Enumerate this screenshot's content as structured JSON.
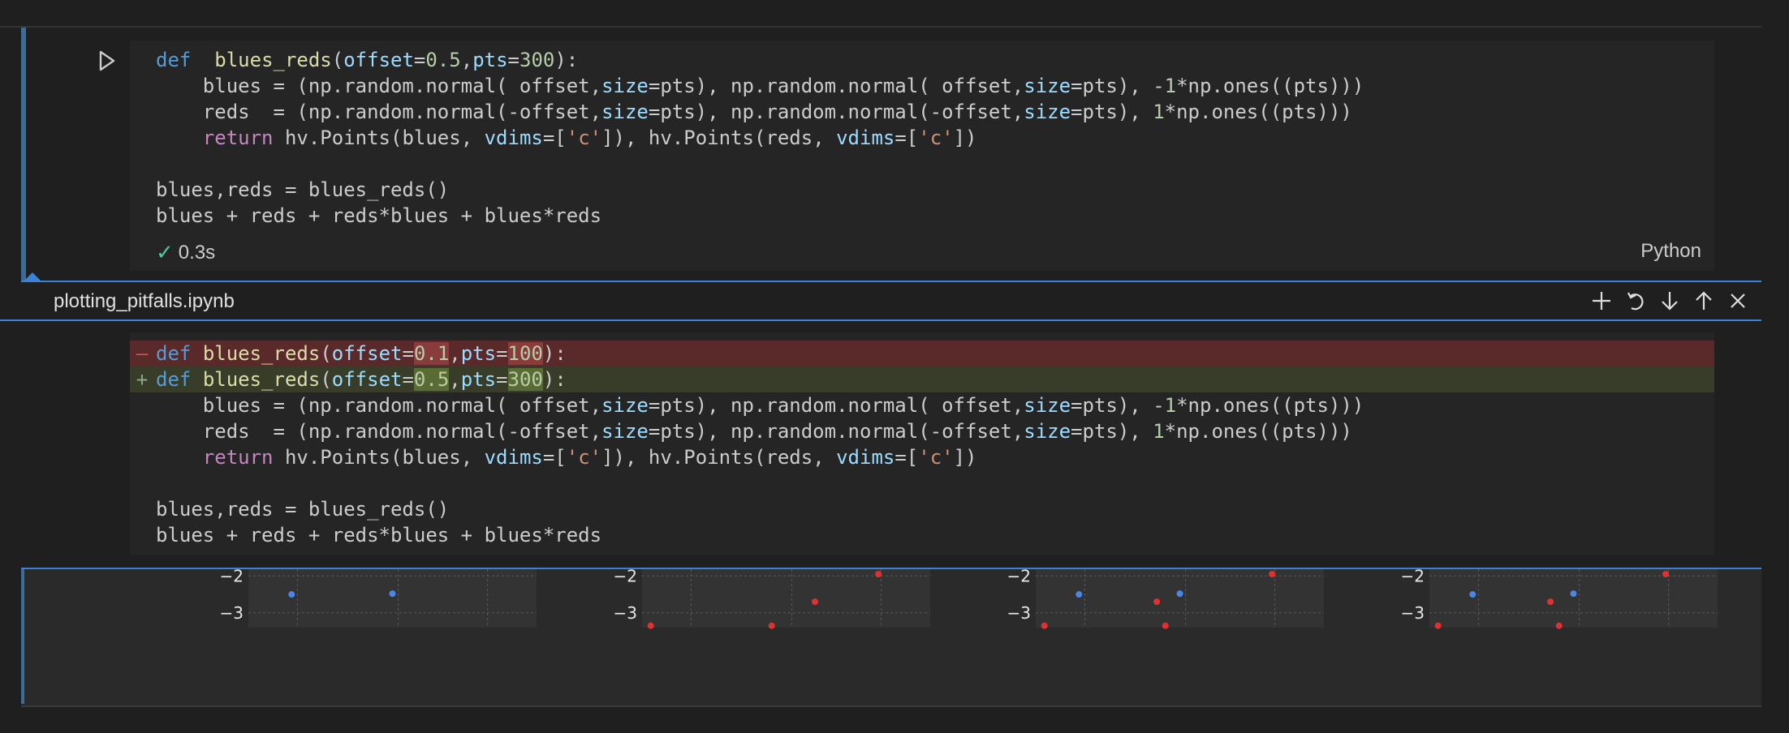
{
  "cell": {
    "code_lines": [
      [
        [
          "kw",
          "def"
        ],
        [
          "",
          "  "
        ],
        [
          "fn",
          "blues_reds"
        ],
        [
          "",
          "("
        ],
        [
          "pa-c",
          "offset"
        ],
        [
          "",
          "="
        ],
        [
          "num",
          "0.5"
        ],
        [
          "",
          ","
        ],
        [
          "pa-c",
          "pts"
        ],
        [
          "",
          "="
        ],
        [
          "num",
          "300"
        ],
        [
          "",
          "):"
        ]
      ],
      [
        [
          "",
          "    blues = (np.random.normal( offset,"
        ],
        [
          "pa-c",
          "size"
        ],
        [
          "",
          "=pts), np.random.normal( offset,"
        ],
        [
          "pa-c",
          "size"
        ],
        [
          "",
          "=pts), -"
        ],
        [
          "num",
          "1"
        ],
        [
          "",
          "*np.ones((pts)))"
        ]
      ],
      [
        [
          "",
          "    reds  = (np.random.normal(-offset,"
        ],
        [
          "pa-c",
          "size"
        ],
        [
          "",
          "=pts), np.random.normal(-offset,"
        ],
        [
          "pa-c",
          "size"
        ],
        [
          "",
          "=pts), "
        ],
        [
          "num",
          "1"
        ],
        [
          "",
          "*np.ones((pts)))"
        ]
      ],
      [
        [
          "",
          "    "
        ],
        [
          "kw2",
          "return"
        ],
        [
          "",
          " hv.Points(blues, "
        ],
        [
          "pa-c",
          "vdims"
        ],
        [
          "",
          "=["
        ],
        [
          "str",
          "'c'"
        ],
        [
          "",
          "]), hv.Points(reds, "
        ],
        [
          "pa-c",
          "vdims"
        ],
        [
          "",
          "=["
        ],
        [
          "str",
          "'c'"
        ],
        [
          "",
          "])"
        ]
      ],
      [
        [
          "",
          ""
        ]
      ],
      [
        [
          "",
          "blues,reds = blues_reds()"
        ]
      ],
      [
        [
          "",
          "blues + reds + reds*blues + blues*reds"
        ]
      ]
    ],
    "status_check": "✓",
    "exec_time": "0.3s",
    "language": "Python"
  },
  "peek": {
    "title": "plotting_pitfalls.ipynb",
    "actions": [
      "add-icon",
      "revert-icon",
      "arrow-down-icon",
      "arrow-up-icon",
      "close-icon"
    ]
  },
  "diff": {
    "del_marker": "—",
    "add_marker": "+",
    "del_line": [
      [
        "kw",
        "def"
      ],
      [
        "",
        " "
      ],
      [
        "fn",
        "blues_reds"
      ],
      [
        "",
        "("
      ],
      [
        "pa-c",
        "offset"
      ],
      [
        "",
        "="
      ],
      [
        "hl-del num",
        "0.1"
      ],
      [
        "",
        ","
      ],
      [
        "pa-c",
        "pts"
      ],
      [
        "",
        "="
      ],
      [
        "hl-del num",
        "100"
      ],
      [
        "",
        "):"
      ]
    ],
    "add_line": [
      [
        "kw",
        "def"
      ],
      [
        "",
        " "
      ],
      [
        "fn",
        "blues_reds"
      ],
      [
        "",
        "("
      ],
      [
        "pa-c",
        "offset"
      ],
      [
        "",
        "="
      ],
      [
        "hl-add num",
        "0.5"
      ],
      [
        "",
        ","
      ],
      [
        "pa-c",
        "pts"
      ],
      [
        "",
        "="
      ],
      [
        "hl-add num",
        "300"
      ],
      [
        "",
        "):"
      ]
    ],
    "rest_lines": [
      [
        [
          "",
          "    blues = (np.random.normal( offset,"
        ],
        [
          "pa-c",
          "size"
        ],
        [
          "",
          "=pts), np.random.normal( offset,"
        ],
        [
          "pa-c",
          "size"
        ],
        [
          "",
          "=pts), -"
        ],
        [
          "num",
          "1"
        ],
        [
          "",
          "*np.ones((pts)))"
        ]
      ],
      [
        [
          "",
          "    reds  = (np.random.normal(-offset,"
        ],
        [
          "pa-c",
          "size"
        ],
        [
          "",
          "=pts), np.random.normal(-offset,"
        ],
        [
          "pa-c",
          "size"
        ],
        [
          "",
          "=pts), "
        ],
        [
          "num",
          "1"
        ],
        [
          "",
          "*np.ones((pts)))"
        ]
      ],
      [
        [
          "",
          "    "
        ],
        [
          "kw2",
          "return"
        ],
        [
          "",
          " hv.Points(blues, "
        ],
        [
          "pa-c",
          "vdims"
        ],
        [
          "",
          "=["
        ],
        [
          "str",
          "'c'"
        ],
        [
          "",
          "]), hv.Points(reds, "
        ],
        [
          "pa-c",
          "vdims"
        ],
        [
          "",
          "=["
        ],
        [
          "str",
          "'c'"
        ],
        [
          "",
          "])"
        ]
      ],
      [
        [
          "",
          ""
        ]
      ],
      [
        [
          "",
          "blues,reds = blues_reds()"
        ]
      ],
      [
        [
          "",
          "blues + reds + reds*blues + blues*reds"
        ]
      ]
    ]
  },
  "output": {
    "ytick_labels": [
      "−2",
      "−3"
    ],
    "colors": {
      "blue": "#4a86e8",
      "red": "#e03131"
    },
    "plots": [
      {
        "points": [
          {
            "x": 0.15,
            "y": -2.5,
            "c": "blue"
          },
          {
            "x": 0.5,
            "y": -2.48,
            "c": "blue"
          }
        ]
      },
      {
        "points": [
          {
            "x": 0.6,
            "y": -2.7,
            "c": "red"
          },
          {
            "x": 0.82,
            "y": -1.95,
            "c": "red"
          },
          {
            "x": 0.03,
            "y": -3.35,
            "c": "red"
          },
          {
            "x": 0.45,
            "y": -3.35,
            "c": "red"
          }
        ]
      },
      {
        "points": [
          {
            "x": 0.15,
            "y": -2.5,
            "c": "blue"
          },
          {
            "x": 0.5,
            "y": -2.48,
            "c": "blue"
          },
          {
            "x": 0.42,
            "y": -2.7,
            "c": "red"
          },
          {
            "x": 0.82,
            "y": -1.95,
            "c": "red"
          },
          {
            "x": 0.03,
            "y": -3.35,
            "c": "red"
          },
          {
            "x": 0.45,
            "y": -3.35,
            "c": "red"
          }
        ]
      },
      {
        "points": [
          {
            "x": 0.15,
            "y": -2.5,
            "c": "blue"
          },
          {
            "x": 0.5,
            "y": -2.48,
            "c": "blue"
          },
          {
            "x": 0.42,
            "y": -2.7,
            "c": "red"
          },
          {
            "x": 0.82,
            "y": -1.95,
            "c": "red"
          },
          {
            "x": 0.03,
            "y": -3.35,
            "c": "red"
          },
          {
            "x": 0.45,
            "y": -3.35,
            "c": "red"
          }
        ]
      }
    ]
  }
}
